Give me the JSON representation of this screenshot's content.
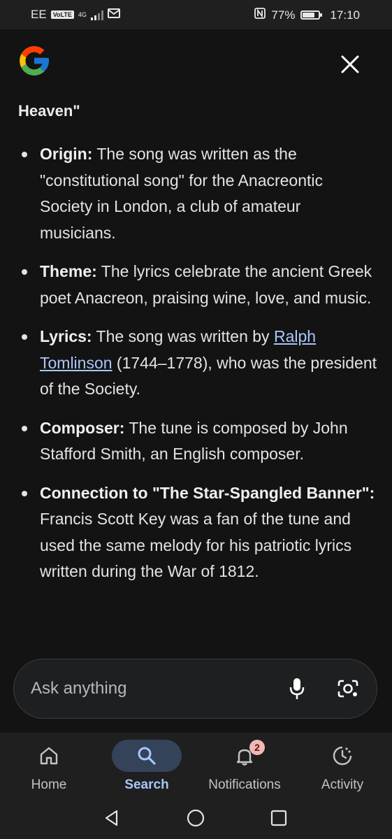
{
  "status_bar": {
    "carrier": "EE",
    "volte": "VoLTE",
    "network": "4G",
    "battery_percent": "77%",
    "battery_level": 0.77,
    "time": "17:10"
  },
  "content": {
    "heading_fragment": "Heaven\"",
    "bullets": [
      {
        "term": "Origin:",
        "text": " The song was written as the \"constitutional song\" for the Anacreontic Society in London, a club of amateur musicians."
      },
      {
        "term": "Theme:",
        "text": " The lyrics celebrate the ancient Greek poet Anacreon, praising wine, love, and music."
      },
      {
        "term": "Lyrics:",
        "text_before": " The song was written by ",
        "link": "Ralph Tomlinson",
        "text_after": " (1744–1778), who was the president of the Society."
      },
      {
        "term": "Composer:",
        "text": " The tune is composed by John Stafford Smith, an English composer."
      },
      {
        "term": "Connection to \"The Star-Spangled Banner\":",
        "text": " Francis Scott Key was a fan of the tune and used the same melody for his patriotic lyrics written during the War of 1812."
      }
    ]
  },
  "ask_bar": {
    "placeholder": "Ask anything"
  },
  "bottom_nav": [
    {
      "label": "Home",
      "icon": "home-icon",
      "active": false
    },
    {
      "label": "Search",
      "icon": "search-icon",
      "active": true
    },
    {
      "label": "Notifications",
      "icon": "bell-icon",
      "active": false,
      "badge": "2"
    },
    {
      "label": "Activity",
      "icon": "activity-icon",
      "active": false
    }
  ],
  "colors": {
    "background": "#131314",
    "chrome": "#1f1f1f",
    "link": "#a8c7fa",
    "active_pill": "#34435a",
    "badge": "#f2b8b5"
  }
}
